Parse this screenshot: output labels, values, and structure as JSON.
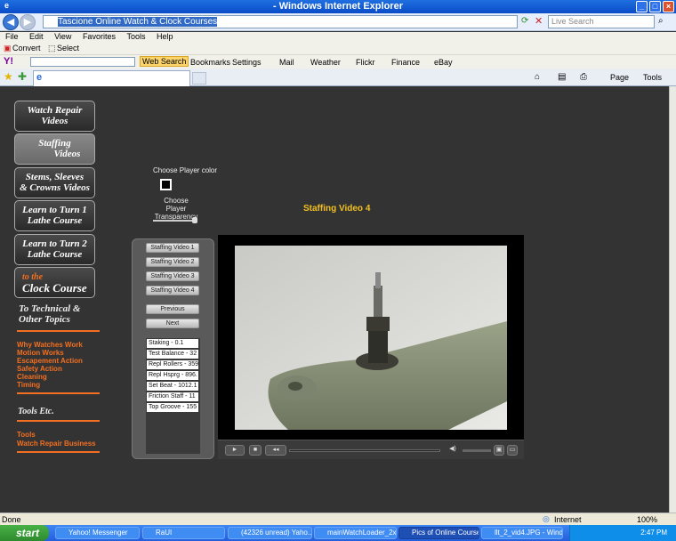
{
  "window": {
    "title": "- Windows Internet Explorer"
  },
  "address": {
    "url": "Tascione Online Watch & Clock Courses",
    "search_placeholder": "Live Search"
  },
  "menu": [
    "File",
    "Edit",
    "View",
    "Favorites",
    "Tools",
    "Help"
  ],
  "convert_bar": {
    "convert": "Convert",
    "select": "Select"
  },
  "yahoo_bar": {
    "web_search": "Web Search",
    "bookmarks": "Bookmarks",
    "settings": "Settings",
    "mail": "Mail",
    "weather": "Weather",
    "flickr": "Flickr",
    "finance": "Finance",
    "ebay": "eBay"
  },
  "command_bar": {
    "page": "Page",
    "tools": "Tools"
  },
  "nav": [
    {
      "line1": "Watch Repair",
      "line2": "Videos"
    },
    {
      "line1": "Staffing",
      "line2": "Videos"
    },
    {
      "line1": "Stems, Sleeves",
      "line2": "& Crowns Videos"
    },
    {
      "line1": "Learn to Turn 1",
      "line2": "Lathe Course"
    },
    {
      "line1": "Learn to Turn 2",
      "line2": "Lathe Course"
    },
    {
      "line1": "to the",
      "line2": "Clock Course"
    }
  ],
  "technical": {
    "heading_line1": "To Technical &",
    "heading_line2": "Other Topics",
    "links": [
      "Why Watches Work",
      "Motion Works",
      "Escapement Action",
      "Safety Action",
      "Cleaning",
      "Timing"
    ]
  },
  "tools": {
    "heading": "Tools Etc.",
    "links": [
      "Tools",
      "Watch Repair Business"
    ]
  },
  "player_options": {
    "color_label": "Choose Player color",
    "transparency_label_1": "Choose Player",
    "transparency_label_2": "Transparency"
  },
  "video_title": "Staffing Video 4",
  "playlist": {
    "videos": [
      "Staffing Video 1",
      "Staffing Video 2",
      "Staffing Video 3",
      "Staffing Video 4"
    ],
    "previous": "Previous",
    "next": "Next",
    "chapters": [
      "Staking - 0.1",
      "Test Balance - 32",
      "Repl Rollers - 359",
      "Repl Hsprg - 896.",
      "Set Beat - 1012.1",
      "Friction Staff - 11",
      "Top Groove - 155"
    ]
  },
  "status": {
    "left": "Done",
    "zone": "Internet",
    "zoom": "100%"
  },
  "taskbar": {
    "start": "start",
    "tasks": [
      "Yahoo! Messenger",
      "RaUI",
      "(42326 unread) Yaho...",
      "mainWatchLoader_2x...",
      "Pics of Online Courses",
      "llt_2_vid4.JPG - Wind..."
    ],
    "time": "2:47 PM"
  },
  "colors": {
    "accent_orange": "#f36f21",
    "video_title": "#f0c020",
    "page_bg": "#333333"
  }
}
